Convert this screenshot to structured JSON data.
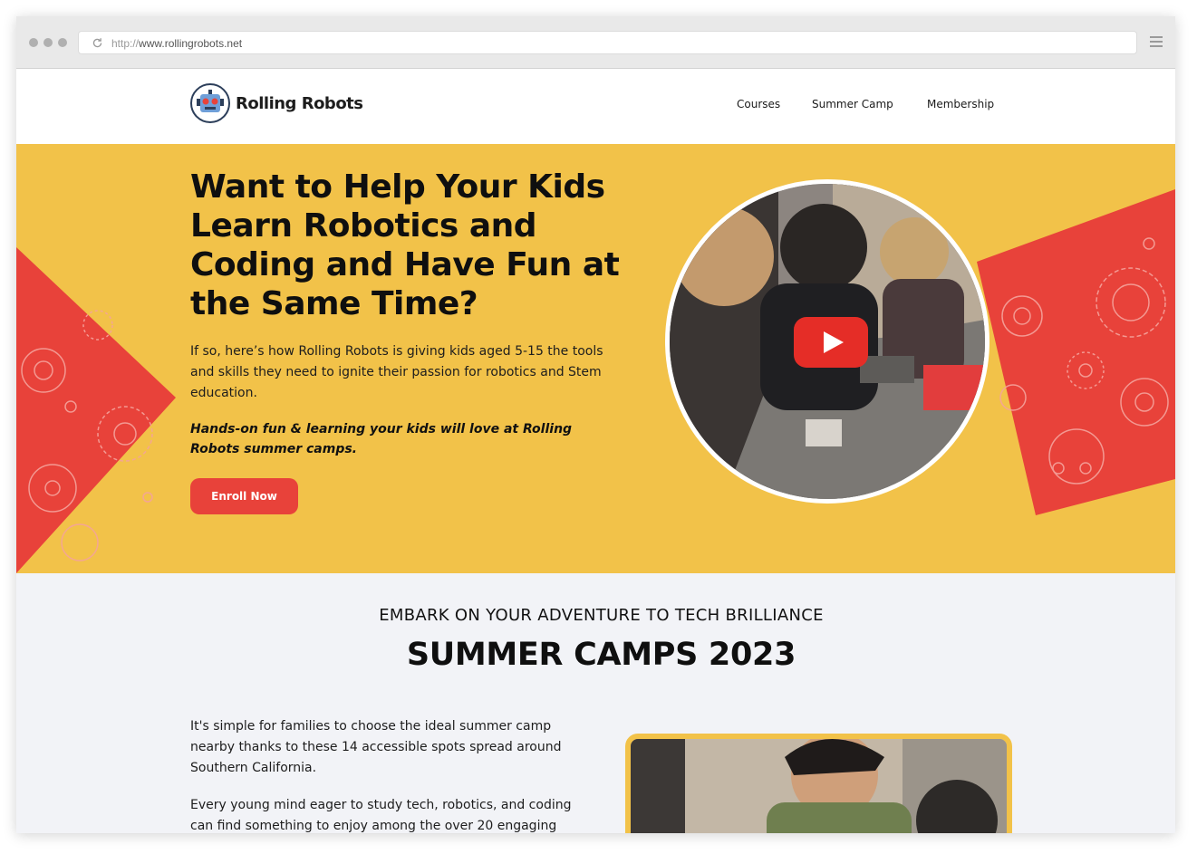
{
  "browser": {
    "url_protocol": "http://",
    "url_host": "www.rollingrobots.net"
  },
  "header": {
    "logo_text": "Rolling Robots",
    "nav": [
      "Courses",
      "Summer Camp",
      "Membership"
    ]
  },
  "hero": {
    "title": "Want to Help Your Kids Learn Robotics and Coding and Have Fun at the Same Time?",
    "body": "If so, here’s how Rolling Robots is giving kids aged 5-15 the tools and skills they need to ignite their passion for robotics and Stem education.",
    "tagline": "Hands-on fun & learning your kids will love at Rolling Robots summer camps.",
    "cta": "Enroll Now",
    "video_icon": "youtube-play-icon"
  },
  "camps": {
    "eyebrow": "EMBARK ON YOUR ADVENTURE TO TECH BRILLIANCE",
    "title": "SUMMER CAMPS 2023",
    "paragraphs": [
      "It's simple for families to choose the ideal summer camp nearby thanks to these 14 accessible spots spread around Southern California.",
      "Every young mind eager to study tech, robotics, and coding can find something to enjoy among the over 20 engaging"
    ]
  },
  "colors": {
    "hero_bg": "#f2c249",
    "accent_red": "#e8423a",
    "section_bg": "#f2f3f7"
  }
}
